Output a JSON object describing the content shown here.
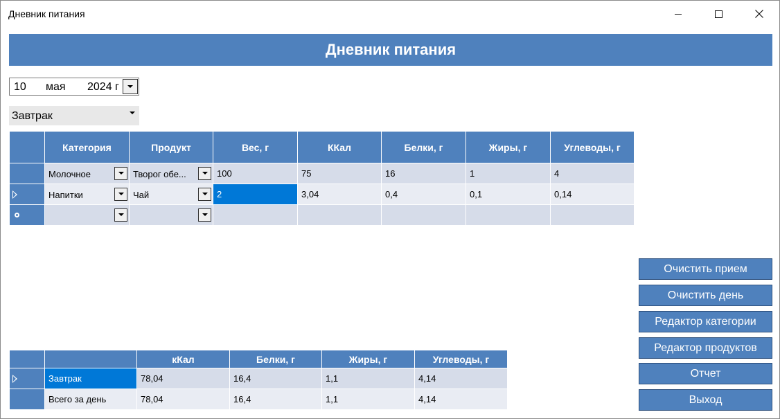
{
  "window": {
    "title": "Дневник питания"
  },
  "header": {
    "title": "Дневник питания"
  },
  "date_picker": {
    "day": "10",
    "month": "мая",
    "year": "2024 г"
  },
  "meal_select": {
    "value": "Завтрак"
  },
  "entries_table": {
    "columns": [
      "Категория",
      "Продукт",
      "Вес, г",
      "ККал",
      "Белки, г",
      "Жиры, г",
      "Углеводы, г"
    ],
    "rows": [
      {
        "category": "Молочное",
        "product": "Творог обе...",
        "weight": "100",
        "kcal": "75",
        "protein": "16",
        "fat": "1",
        "carbs": "4"
      },
      {
        "category": "Напитки",
        "product": "Чай",
        "weight": "2",
        "kcal": "3,04",
        "protein": "0,4",
        "fat": "0,1",
        "carbs": "0,14"
      }
    ]
  },
  "summary_table": {
    "columns": [
      "кКал",
      "Белки, г",
      "Жиры, г",
      "Углеводы, г"
    ],
    "rows": [
      {
        "label": "Завтрак",
        "kcal": "78,04",
        "protein": "16,4",
        "fat": "1,1",
        "carbs": "4,14"
      },
      {
        "label": "Всего за день",
        "kcal": "78,04",
        "protein": "16,4",
        "fat": "1,1",
        "carbs": "4,14"
      }
    ]
  },
  "actions": {
    "clear_meal": "Очистить прием",
    "clear_day": "Очистить день",
    "category_editor": "Редактор категории",
    "product_editor": "Редактор продуктов",
    "report": "Отчет",
    "exit": "Выход"
  },
  "colors": {
    "accent": "#4f81bd",
    "selection": "#0078d7",
    "row_odd": "#d6dce9",
    "row_even": "#e9ecf3"
  }
}
